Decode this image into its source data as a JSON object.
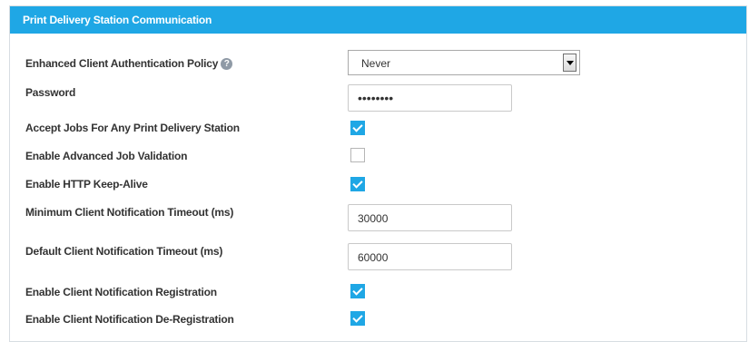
{
  "panel": {
    "title": "Print Delivery Station Communication"
  },
  "fields": {
    "auth_policy": {
      "label": "Enhanced Client Authentication Policy",
      "value": "Never",
      "help_icon": "question-circle-icon"
    },
    "password": {
      "label": "Password",
      "value": "••••••••"
    },
    "accept_jobs": {
      "label": "Accept Jobs For Any Print Delivery Station",
      "checked": true
    },
    "advanced_validation": {
      "label": "Enable Advanced Job Validation",
      "checked": false
    },
    "keep_alive": {
      "label": "Enable HTTP Keep-Alive",
      "checked": true
    },
    "min_timeout": {
      "label": "Minimum Client Notification Timeout (ms)",
      "value": "30000"
    },
    "default_timeout": {
      "label": "Default Client Notification Timeout (ms)",
      "value": "60000"
    },
    "notif_registration": {
      "label": "Enable Client Notification Registration",
      "checked": true
    },
    "notif_deregistration": {
      "label": "Enable Client Notification De-Registration",
      "checked": true
    }
  },
  "colors": {
    "header_bg": "#1fa7e5",
    "checkbox_checked": "#1fa7e5",
    "label_text": "#333333"
  }
}
